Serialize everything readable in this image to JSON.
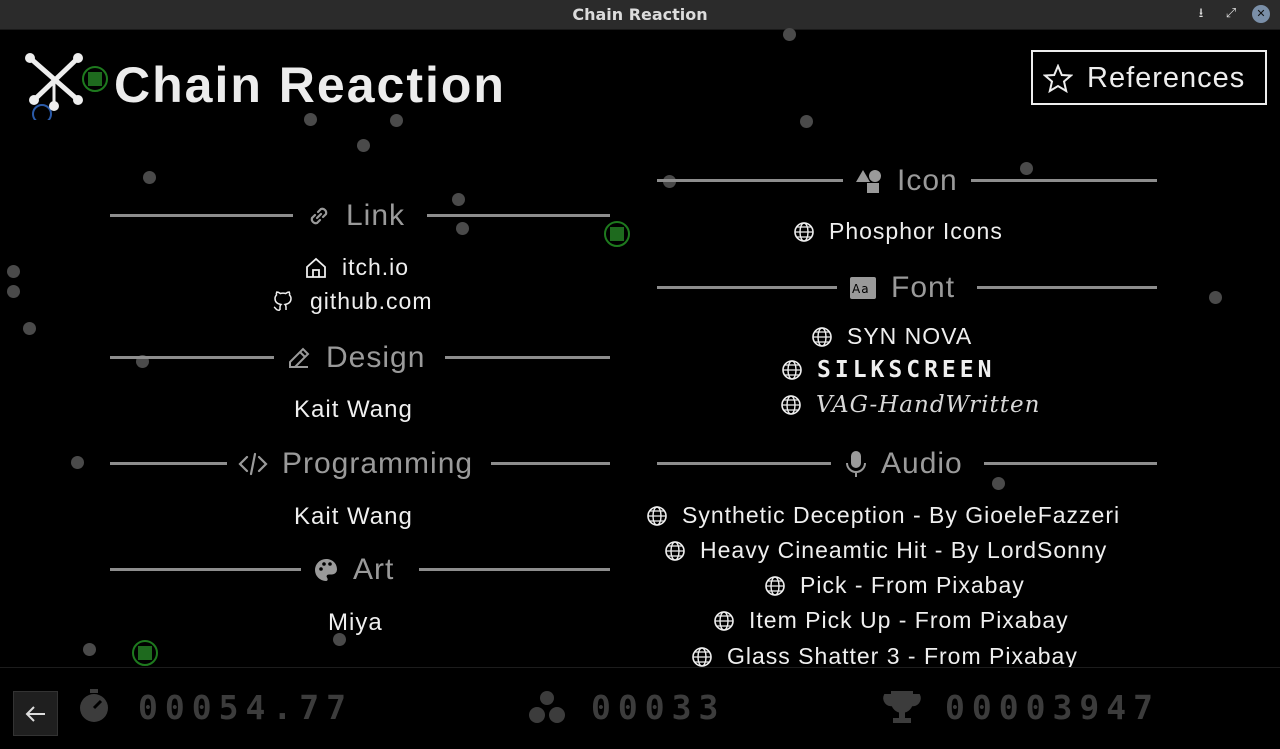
{
  "window": {
    "title": "Chain Reaction"
  },
  "app": {
    "title": "Chain Reaction"
  },
  "references_button": {
    "label": "References"
  },
  "left": {
    "link": {
      "heading": "Link",
      "items": [
        "itch.io",
        "github.com"
      ]
    },
    "design": {
      "heading": "Design",
      "name": "Kait Wang"
    },
    "programming": {
      "heading": "Programming",
      "name": "Kait Wang"
    },
    "art": {
      "heading": "Art",
      "name": "Miya"
    }
  },
  "right": {
    "icon": {
      "heading": "Icon",
      "items": [
        "Phosphor Icons"
      ]
    },
    "font": {
      "heading": "Font",
      "items": [
        "SYN NOVA",
        "SILKSCREEN",
        "VAG-HandWritten"
      ]
    },
    "audio": {
      "heading": "Audio",
      "items": [
        "Synthetic Deception - By GioeleFazzeri",
        "Heavy Cineamtic Hit - By LordSonny",
        "Pick - From Pixabay",
        "Item Pick Up - From Pixabay",
        "Glass Shatter 3 - From Pixabay"
      ]
    }
  },
  "stats": {
    "timer": "00054.77",
    "count": "00033",
    "score": "00003947"
  },
  "colors": {
    "background": "#000000",
    "line": "#8d8d8d",
    "heading": "#9a9a9a",
    "green": "#1e7a1e",
    "stat": "#3c3c3c"
  }
}
